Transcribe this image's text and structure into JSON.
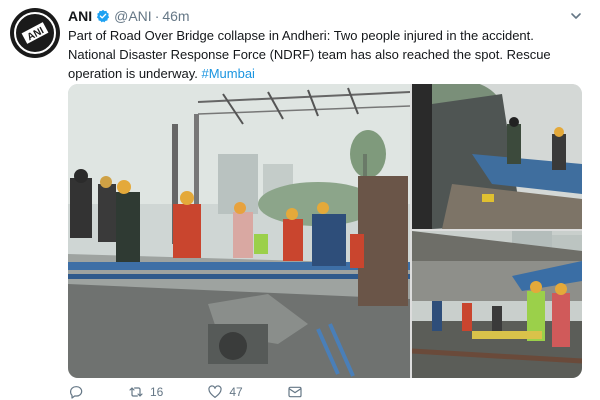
{
  "tweet": {
    "author_name": "ANI",
    "handle": "@ANI",
    "separator": "·",
    "time": "46m",
    "text_line1": "Part of Road Over Bridge collapse in Andheri: Two people injured in the accident.",
    "text_line2": "National Disaster Response Force (NDRF) team has also reached the spot. Rescue",
    "text_line3": "operation is underway.",
    "hashtag": "#Mumbai"
  },
  "avatar_logo_text": "ANI",
  "actions": {
    "retweets": "16",
    "likes": "47"
  },
  "colors": {
    "link": "#1b95e0",
    "verified": "#1da1f2",
    "secondary": "#657786"
  },
  "icons": [
    "verified-icon",
    "caret-down-icon",
    "reply-icon",
    "retweet-icon",
    "like-icon",
    "message-icon"
  ]
}
